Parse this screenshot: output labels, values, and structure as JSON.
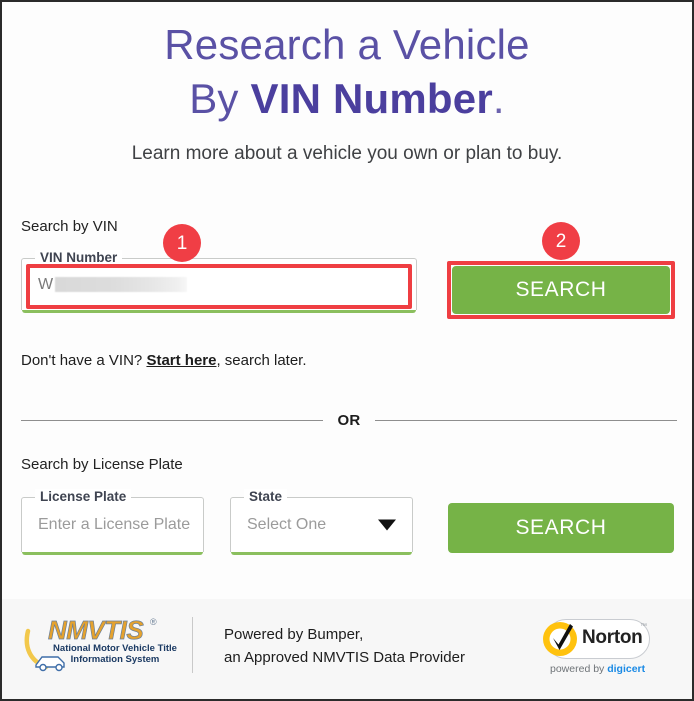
{
  "hero": {
    "title_line1": "Research a Vehicle",
    "title_line2_prefix": "By ",
    "title_line2_strong": "VIN Number",
    "title_line2_suffix": ".",
    "subtitle": "Learn more about a vehicle you own or plan to buy."
  },
  "vin_section": {
    "label": "Search by VIN",
    "field_legend": "VIN Number",
    "field_value": "W",
    "field_value_redacted": true,
    "search_button": "SEARCH",
    "help_prefix": "Don't have a VIN? ",
    "help_link": "Start here",
    "help_suffix": ", search later."
  },
  "divider": {
    "text": "OR"
  },
  "plate_section": {
    "label": "Search by License Plate",
    "plate_legend": "License Plate",
    "plate_placeholder": "Enter a License Plate",
    "state_legend": "State",
    "state_selected": "Select One",
    "state_caret_icon": "chevron-down-icon",
    "search_button": "SEARCH"
  },
  "annotations": [
    {
      "number": "1",
      "target": "vin-input"
    },
    {
      "number": "2",
      "target": "vin-search-button"
    }
  ],
  "footer": {
    "nmvtis_word": "NMVTIS",
    "nmvtis_registered": "®",
    "nmvtis_sub_line1": "National Motor Vehicle Title",
    "nmvtis_sub_line2": "Information System",
    "powered_line1": "Powered by Bumper,",
    "powered_line2": "an Approved NMVTIS Data Provider",
    "norton_brand": "Norton",
    "norton_tm": "™",
    "norton_sub_prefix": "powered by ",
    "norton_sub_brand": "digicert",
    "norton_check_icon": "check-circle-icon"
  },
  "colors": {
    "heading_purple": "#5a51a5",
    "heading_purple_bold": "#4b3f9e",
    "button_green": "#76b347",
    "field_underline_green": "#8bbf5e",
    "annotation_red": "#ef3e42",
    "nmvtis_orange": "#e5a22e",
    "nmvtis_navy": "#1b3a63",
    "norton_yellow": "#ffc20e",
    "digicert_blue": "#1a8ae5"
  }
}
